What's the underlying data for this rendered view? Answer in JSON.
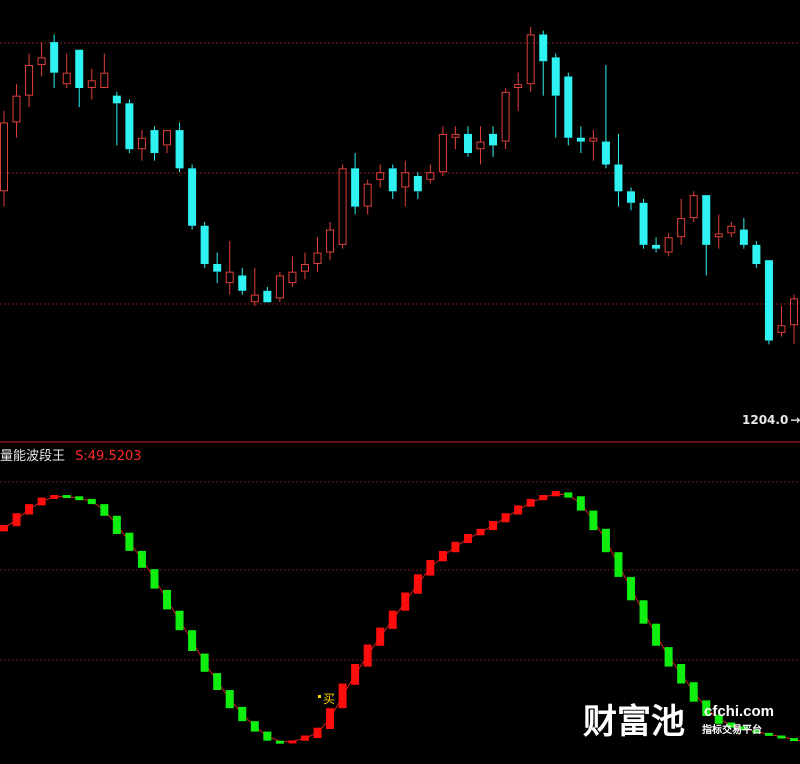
{
  "colors": {
    "background": "#000000",
    "up_candle": "#e0403a",
    "down_candle": "#2ff2f2",
    "divider": "#d02020",
    "grid": "#7a1a1a",
    "indicator_up": "#ff0d0d",
    "indicator_down": "#10ee10",
    "indicator_line": "#d02020",
    "title_text": "#e8e8e8",
    "value_text": "#ff2a2a",
    "buy_text": "#ffd400",
    "watermark": "#ffffff"
  },
  "indicator": {
    "name": "量能波段王",
    "value_text": "S:49.5203"
  },
  "price_label": "1204.0",
  "buy_label": "买",
  "watermark": {
    "brand": "财富池",
    "url": "cfchi.com",
    "subtitle": "指标交易平台"
  },
  "chart_data": [
    {
      "type": "candlestick",
      "title": "",
      "grid": true,
      "series": [
        {
          "values": [
            {
              "open": 1240,
              "close": 1258,
              "high": 1261,
              "low": 1236,
              "color": "up"
            },
            {
              "open": 1258,
              "close": 1265,
              "high": 1268,
              "low": 1254,
              "color": "up"
            },
            {
              "open": 1265,
              "close": 1273,
              "high": 1276,
              "low": 1262,
              "color": "up"
            },
            {
              "open": 1273,
              "close": 1275,
              "high": 1279,
              "low": 1270,
              "color": "up"
            },
            {
              "open": 1279,
              "close": 1271,
              "high": 1281,
              "low": 1267,
              "color": "down"
            },
            {
              "open": 1271,
              "close": 1268,
              "high": 1276,
              "low": 1267,
              "color": "up"
            },
            {
              "open": 1277,
              "close": 1267,
              "high": 1277,
              "low": 1262,
              "color": "down"
            },
            {
              "open": 1267,
              "close": 1269,
              "high": 1272,
              "low": 1264,
              "color": "up"
            },
            {
              "open": 1267,
              "close": 1271,
              "high": 1276,
              "low": 1267,
              "color": "up"
            },
            {
              "open": 1265,
              "close": 1263,
              "high": 1266,
              "low": 1252,
              "color": "down"
            },
            {
              "open": 1263,
              "close": 1251,
              "high": 1264,
              "low": 1250,
              "color": "down"
            },
            {
              "open": 1254,
              "close": 1251,
              "high": 1256,
              "low": 1248,
              "color": "up"
            },
            {
              "open": 1256,
              "close": 1250,
              "high": 1257,
              "low": 1248,
              "color": "down"
            },
            {
              "open": 1252,
              "close": 1256,
              "high": 1256,
              "low": 1250,
              "color": "up"
            },
            {
              "open": 1256,
              "close": 1246,
              "high": 1258,
              "low": 1245,
              "color": "down"
            },
            {
              "open": 1246,
              "close": 1231,
              "high": 1247,
              "low": 1230,
              "color": "down"
            },
            {
              "open": 1231,
              "close": 1221,
              "high": 1232,
              "low": 1220,
              "color": "down"
            },
            {
              "open": 1221,
              "close": 1219,
              "high": 1224,
              "low": 1216,
              "color": "down"
            },
            {
              "open": 1216,
              "close": 1219,
              "high": 1227,
              "low": 1213,
              "color": "up"
            },
            {
              "open": 1218,
              "close": 1214,
              "high": 1220,
              "low": 1213,
              "color": "down"
            },
            {
              "open": 1211,
              "close": 1213,
              "high": 1220,
              "low": 1210,
              "color": "up"
            },
            {
              "open": 1214,
              "close": 1211,
              "high": 1215,
              "low": 1212,
              "color": "down"
            },
            {
              "open": 1212,
              "close": 1218,
              "high": 1219,
              "low": 1211,
              "color": "up"
            },
            {
              "open": 1216,
              "close": 1219,
              "high": 1223,
              "low": 1215,
              "color": "up"
            },
            {
              "open": 1219,
              "close": 1221,
              "high": 1224,
              "low": 1217,
              "color": "up"
            },
            {
              "open": 1221,
              "close": 1224,
              "high": 1228,
              "low": 1219,
              "color": "up"
            },
            {
              "open": 1224,
              "close": 1230,
              "high": 1232,
              "low": 1222,
              "color": "up"
            },
            {
              "open": 1226,
              "close": 1246,
              "high": 1247,
              "low": 1225,
              "color": "up"
            },
            {
              "open": 1246,
              "close": 1236,
              "high": 1250,
              "low": 1234,
              "color": "down"
            },
            {
              "open": 1236,
              "close": 1242,
              "high": 1243,
              "low": 1234,
              "color": "up"
            },
            {
              "open": 1245,
              "close": 1243,
              "high": 1247,
              "low": 1241,
              "color": "up"
            },
            {
              "open": 1246,
              "close": 1240,
              "high": 1247,
              "low": 1238,
              "color": "down"
            },
            {
              "open": 1241,
              "close": 1245,
              "high": 1248,
              "low": 1236,
              "color": "up"
            },
            {
              "open": 1244,
              "close": 1240,
              "high": 1245,
              "low": 1238,
              "color": "down"
            },
            {
              "open": 1243,
              "close": 1245,
              "high": 1247,
              "low": 1242,
              "color": "up"
            },
            {
              "open": 1245,
              "close": 1255,
              "high": 1257,
              "low": 1244,
              "color": "up"
            },
            {
              "open": 1254,
              "close": 1255,
              "high": 1257,
              "low": 1251,
              "color": "up"
            },
            {
              "open": 1255,
              "close": 1250,
              "high": 1257,
              "low": 1249,
              "color": "down"
            },
            {
              "open": 1251,
              "close": 1253,
              "high": 1257,
              "low": 1247,
              "color": "up"
            },
            {
              "open": 1255,
              "close": 1252,
              "high": 1257,
              "low": 1249,
              "color": "down"
            },
            {
              "open": 1253,
              "close": 1266,
              "high": 1267,
              "low": 1251,
              "color": "up"
            },
            {
              "open": 1267,
              "close": 1268,
              "high": 1271,
              "low": 1261,
              "color": "up"
            },
            {
              "open": 1268,
              "close": 1281,
              "high": 1283,
              "low": 1266,
              "color": "up"
            },
            {
              "open": 1281,
              "close": 1274,
              "high": 1282,
              "low": 1265,
              "color": "down"
            },
            {
              "open": 1275,
              "close": 1265,
              "high": 1276,
              "low": 1254,
              "color": "down"
            },
            {
              "open": 1270,
              "close": 1254,
              "high": 1271,
              "low": 1252,
              "color": "down"
            },
            {
              "open": 1254,
              "close": 1253,
              "high": 1257,
              "low": 1250,
              "color": "down"
            },
            {
              "open": 1254,
              "close": 1253,
              "high": 1256,
              "low": 1248,
              "color": "up"
            },
            {
              "open": 1253,
              "close": 1247,
              "high": 1273,
              "low": 1246,
              "color": "down"
            },
            {
              "open": 1247,
              "close": 1240,
              "high": 1255,
              "low": 1236,
              "color": "down"
            },
            {
              "open": 1240,
              "close": 1237,
              "high": 1241,
              "low": 1235,
              "color": "down"
            },
            {
              "open": 1237,
              "close": 1226,
              "high": 1238,
              "low": 1225,
              "color": "down"
            },
            {
              "open": 1226,
              "close": 1225,
              "high": 1228,
              "low": 1224,
              "color": "down"
            },
            {
              "open": 1224,
              "close": 1228,
              "high": 1229,
              "low": 1223,
              "color": "up"
            },
            {
              "open": 1228,
              "close": 1233,
              "high": 1238,
              "low": 1226,
              "color": "up"
            },
            {
              "open": 1233,
              "close": 1239,
              "high": 1240,
              "low": 1232,
              "color": "up"
            },
            {
              "open": 1239,
              "close": 1226,
              "high": 1239,
              "low": 1218,
              "color": "down"
            },
            {
              "open": 1228,
              "close": 1229,
              "high": 1234,
              "low": 1225,
              "color": "up"
            },
            {
              "open": 1229,
              "close": 1231,
              "high": 1232,
              "low": 1228,
              "color": "up"
            },
            {
              "open": 1230,
              "close": 1226,
              "high": 1233,
              "low": 1225,
              "color": "down"
            },
            {
              "open": 1226,
              "close": 1221,
              "high": 1227,
              "low": 1220,
              "color": "down"
            },
            {
              "open": 1222,
              "close": 1201,
              "high": 1222,
              "low": 1200,
              "color": "down"
            },
            {
              "open": 1203,
              "close": 1205,
              "high": 1210,
              "low": 1202,
              "color": "up"
            },
            {
              "open": 1205,
              "close": 1212,
              "high": 1213,
              "low": 1200,
              "color": "up"
            },
            {
              "open": 1212,
              "close": 1210,
              "high": 1213,
              "low": 1207,
              "color": "up"
            },
            {
              "open": 1208,
              "close": 1191,
              "high": 1211,
              "low": 1189,
              "color": "down"
            },
            {
              "open": 1191,
              "close": 1194,
              "high": 1196,
              "low": 1190,
              "color": "up"
            }
          ]
        }
      ],
      "ylim": [
        1175,
        1290
      ]
    },
    {
      "type": "bar",
      "title": "量能波段王",
      "grid": true,
      "ylim": [
        -5,
        105
      ],
      "series": [
        {
          "values": [
            {
              "low": 81.0,
              "high": 83.5,
              "color": "up"
            },
            {
              "low": 83.0,
              "high": 88.0,
              "color": "up"
            },
            {
              "low": 87.5,
              "high": 91.5,
              "color": "up"
            },
            {
              "low": 91.0,
              "high": 94.0,
              "color": "up"
            },
            {
              "low": 93.5,
              "high": 95.0,
              "color": "up"
            },
            {
              "low": 94.0,
              "high": 95.0,
              "color": "down"
            },
            {
              "low": 93.0,
              "high": 94.5,
              "color": "down"
            },
            {
              "low": 91.5,
              "high": 93.5,
              "color": "down"
            },
            {
              "low": 87.0,
              "high": 91.5,
              "color": "down"
            },
            {
              "low": 80.0,
              "high": 87.0,
              "color": "down"
            },
            {
              "low": 73.5,
              "high": 80.5,
              "color": "down"
            },
            {
              "low": 67.0,
              "high": 73.5,
              "color": "down"
            },
            {
              "low": 59.0,
              "high": 66.5,
              "color": "down"
            },
            {
              "low": 51.0,
              "high": 58.5,
              "color": "down"
            },
            {
              "low": 43.0,
              "high": 50.5,
              "color": "down"
            },
            {
              "low": 35.0,
              "high": 43.0,
              "color": "down"
            },
            {
              "low": 27.0,
              "high": 34.0,
              "color": "down"
            },
            {
              "low": 20.0,
              "high": 26.5,
              "color": "down"
            },
            {
              "low": 13.0,
              "high": 20.0,
              "color": "down"
            },
            {
              "low": 8.0,
              "high": 13.5,
              "color": "down"
            },
            {
              "low": 4.0,
              "high": 8.0,
              "color": "down"
            },
            {
              "low": 0.5,
              "high": 4.0,
              "color": "down"
            },
            {
              "low": 0.0,
              "high": 0.5,
              "color": "down"
            },
            {
              "low": 0.0,
              "high": 0.6,
              "color": "up"
            },
            {
              "low": 0.5,
              "high": 2.5,
              "color": "up"
            },
            {
              "low": 1.5,
              "high": 5.5,
              "color": "up"
            },
            {
              "low": 5.0,
              "high": 13.0,
              "color": "up"
            },
            {
              "low": 13.0,
              "high": 22.5,
              "color": "up"
            },
            {
              "low": 22.0,
              "high": 30.0,
              "color": "up"
            },
            {
              "low": 29.0,
              "high": 37.5,
              "color": "up"
            },
            {
              "low": 37.0,
              "high": 44.0,
              "color": "up"
            },
            {
              "low": 43.5,
              "high": 50.5,
              "color": "up"
            },
            {
              "low": 50.5,
              "high": 57.5,
              "color": "up"
            },
            {
              "low": 57.0,
              "high": 64.5,
              "color": "up"
            },
            {
              "low": 64.0,
              "high": 70.0,
              "color": "up"
            },
            {
              "low": 69.5,
              "high": 73.5,
              "color": "up"
            },
            {
              "low": 73.0,
              "high": 77.0,
              "color": "up"
            },
            {
              "low": 76.5,
              "high": 80.0,
              "color": "up"
            },
            {
              "low": 79.5,
              "high": 82.0,
              "color": "up"
            },
            {
              "low": 81.5,
              "high": 85.0,
              "color": "up"
            },
            {
              "low": 84.5,
              "high": 88.0,
              "color": "up"
            },
            {
              "low": 87.5,
              "high": 91.0,
              "color": "up"
            },
            {
              "low": 90.5,
              "high": 93.5,
              "color": "up"
            },
            {
              "low": 93.0,
              "high": 95.0,
              "color": "up"
            },
            {
              "low": 94.5,
              "high": 96.5,
              "color": "up"
            },
            {
              "low": 94.0,
              "high": 96.0,
              "color": "down"
            },
            {
              "low": 89.0,
              "high": 94.5,
              "color": "down"
            },
            {
              "low": 81.5,
              "high": 89.0,
              "color": "down"
            },
            {
              "low": 73.0,
              "high": 82.0,
              "color": "down"
            },
            {
              "low": 63.5,
              "high": 73.0,
              "color": "down"
            },
            {
              "low": 54.5,
              "high": 63.5,
              "color": "down"
            },
            {
              "low": 45.5,
              "high": 54.5,
              "color": "down"
            },
            {
              "low": 37.0,
              "high": 45.5,
              "color": "down"
            },
            {
              "low": 29.0,
              "high": 36.5,
              "color": "down"
            },
            {
              "low": 22.5,
              "high": 30.0,
              "color": "down"
            },
            {
              "low": 15.5,
              "high": 23.0,
              "color": "down"
            },
            {
              "low": 10.0,
              "high": 16.0,
              "color": "down"
            },
            {
              "low": 7.0,
              "high": 10.5,
              "color": "down"
            },
            {
              "low": 5.5,
              "high": 7.5,
              "color": "down"
            },
            {
              "low": 4.5,
              "high": 6.0,
              "color": "down"
            },
            {
              "low": 3.5,
              "high": 4.5,
              "color": "down"
            },
            {
              "low": 2.5,
              "high": 3.5,
              "color": "down"
            },
            {
              "low": 1.5,
              "high": 2.5,
              "color": "down"
            },
            {
              "low": 0.5,
              "high": 1.5,
              "color": "down"
            },
            {
              "low": -0.5,
              "high": 0.5,
              "color": "down"
            },
            {
              "low": -1.5,
              "high": -0.5,
              "color": "down"
            },
            {
              "low": -2.5,
              "high": -1.5,
              "color": "down"
            }
          ]
        }
      ],
      "buy_signal_index": 26
    }
  ]
}
